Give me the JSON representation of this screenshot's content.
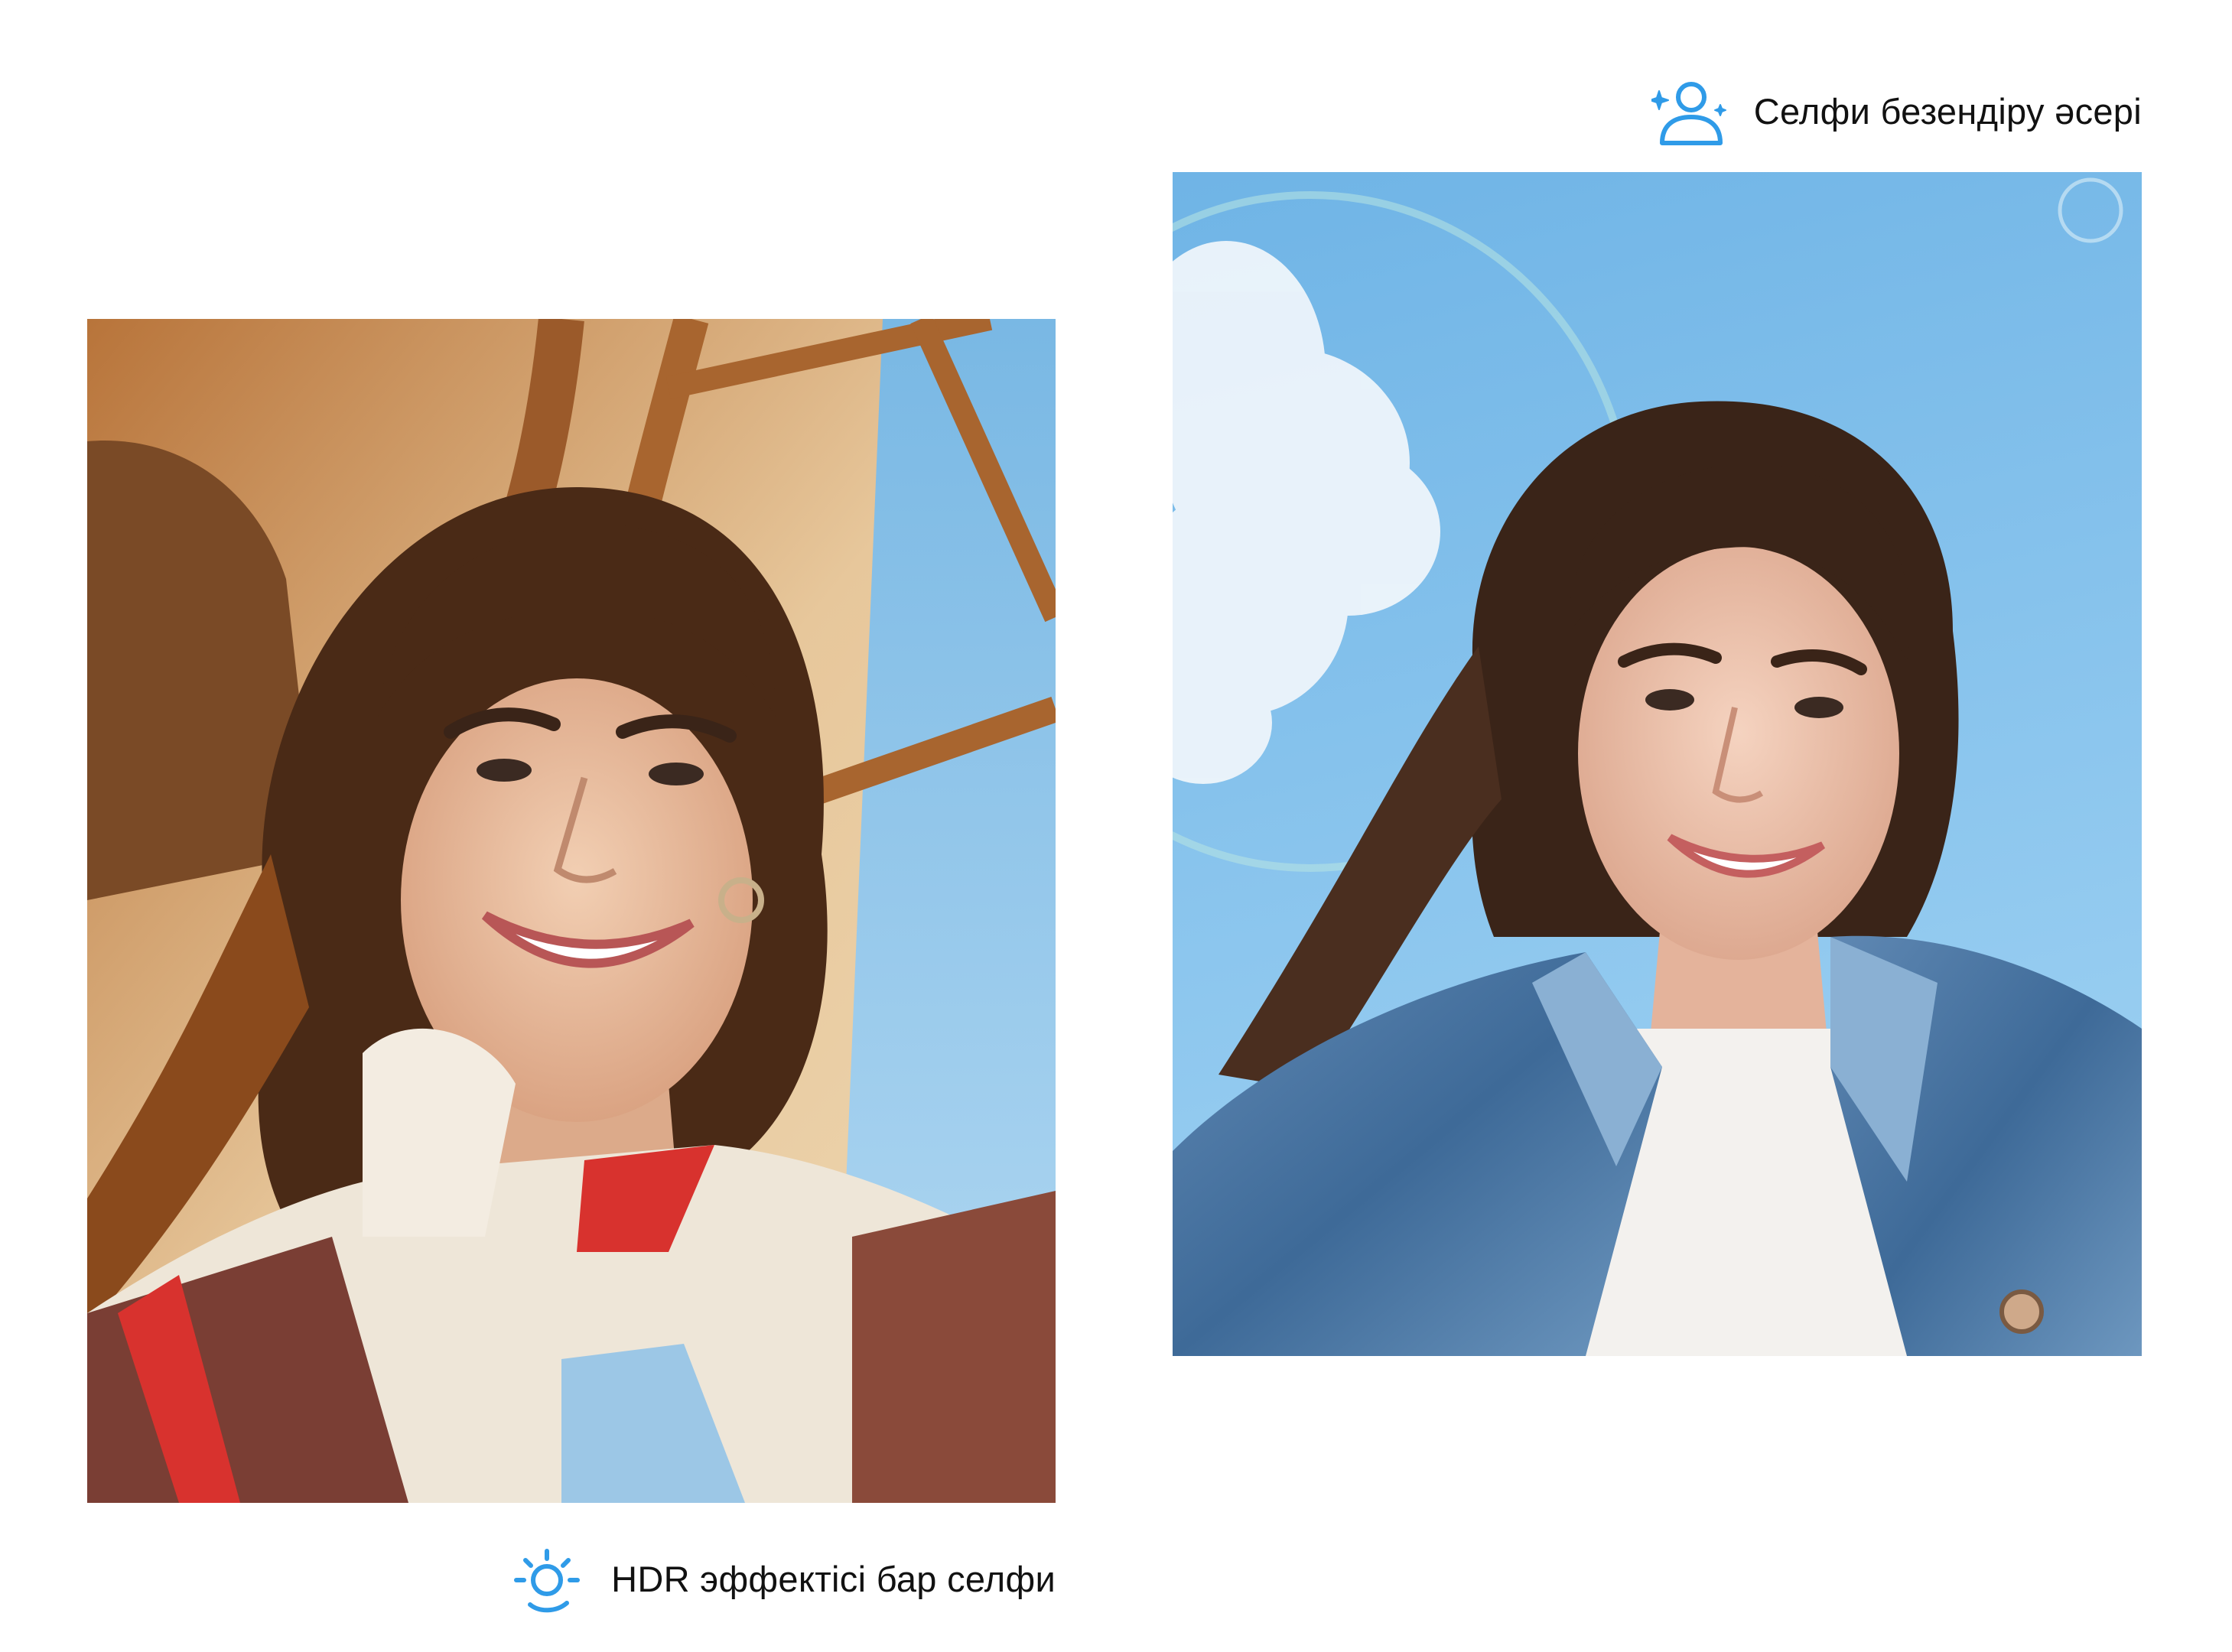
{
  "colors": {
    "accent": "#2f9be8",
    "background": "#ffffff",
    "caption_text": "#111111"
  },
  "captions": {
    "beauty": {
      "text": "Селфи безендіру әсері",
      "icon": "person-sparkle-icon"
    },
    "hdr": {
      "text": "HDR эффектісі бар селфи",
      "icon": "sun-hdr-icon"
    }
  },
  "photos": {
    "hdr_selfie": {
      "subject": "selfie-warm-indoor-window"
    },
    "beauty_selfie": {
      "subject": "selfie-blue-sky-denim-jacket"
    }
  }
}
